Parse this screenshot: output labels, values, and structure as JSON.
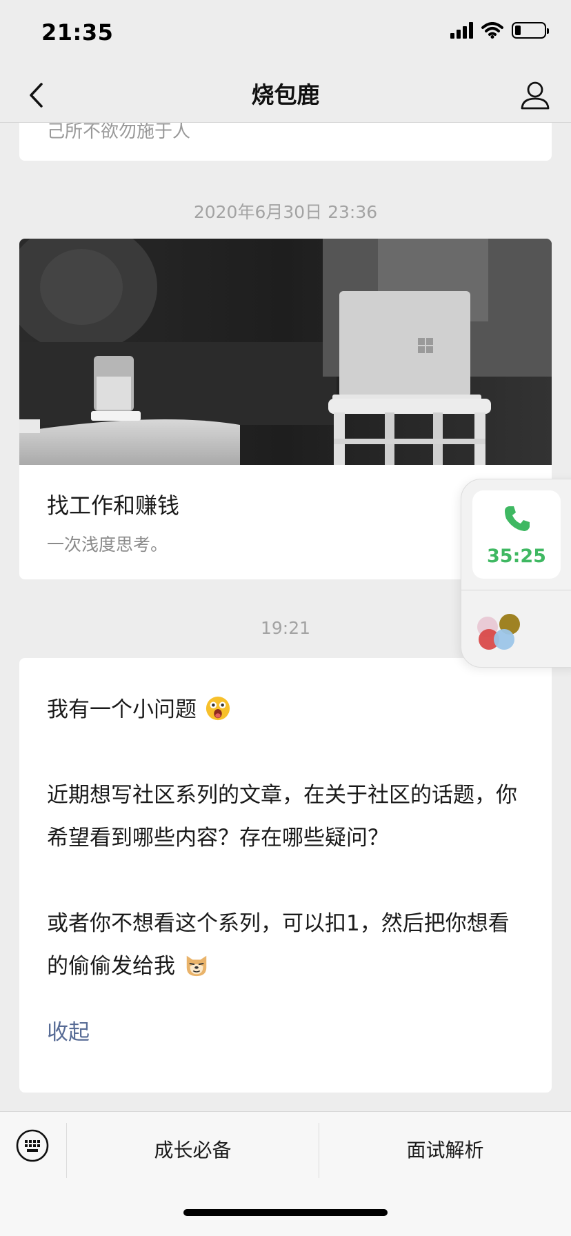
{
  "status_bar": {
    "time": "21:35",
    "battery_level": 0.2
  },
  "nav": {
    "title": "烧包鹿",
    "back_icon": "chevron-left-icon",
    "profile_icon": "person-icon"
  },
  "messages": {
    "previous_card_snippet": "己所不欲勿施于人",
    "timestamp_1": "2020年6月30日 23:36",
    "article": {
      "title": "找工作和赚钱",
      "subtitle": "一次浅度思考。"
    },
    "timestamp_2": "19:21",
    "text_message": {
      "line1": "我有一个小问题",
      "emoji1": "surprised-face-emoji",
      "paragraph2": "近期想写社区系列的文章，在关于社区的话题，你希望看到哪些内容？存在哪些疑问？",
      "paragraph3": "或者你不想看这个系列，可以扣1，然后把你想看的偷偷发给我",
      "emoji2": "doge-emoji",
      "collapse_label": "收起"
    }
  },
  "floating_call": {
    "duration": "35:25",
    "icon": "phone-icon",
    "app_icon": "colorful-circles-app-icon"
  },
  "bottom_menu": {
    "keyboard_icon": "keyboard-icon",
    "items": [
      "成长必备",
      "面试解析"
    ]
  },
  "colors": {
    "background": "#ededed",
    "link": "#576b95",
    "call_green": "#3fb862"
  }
}
